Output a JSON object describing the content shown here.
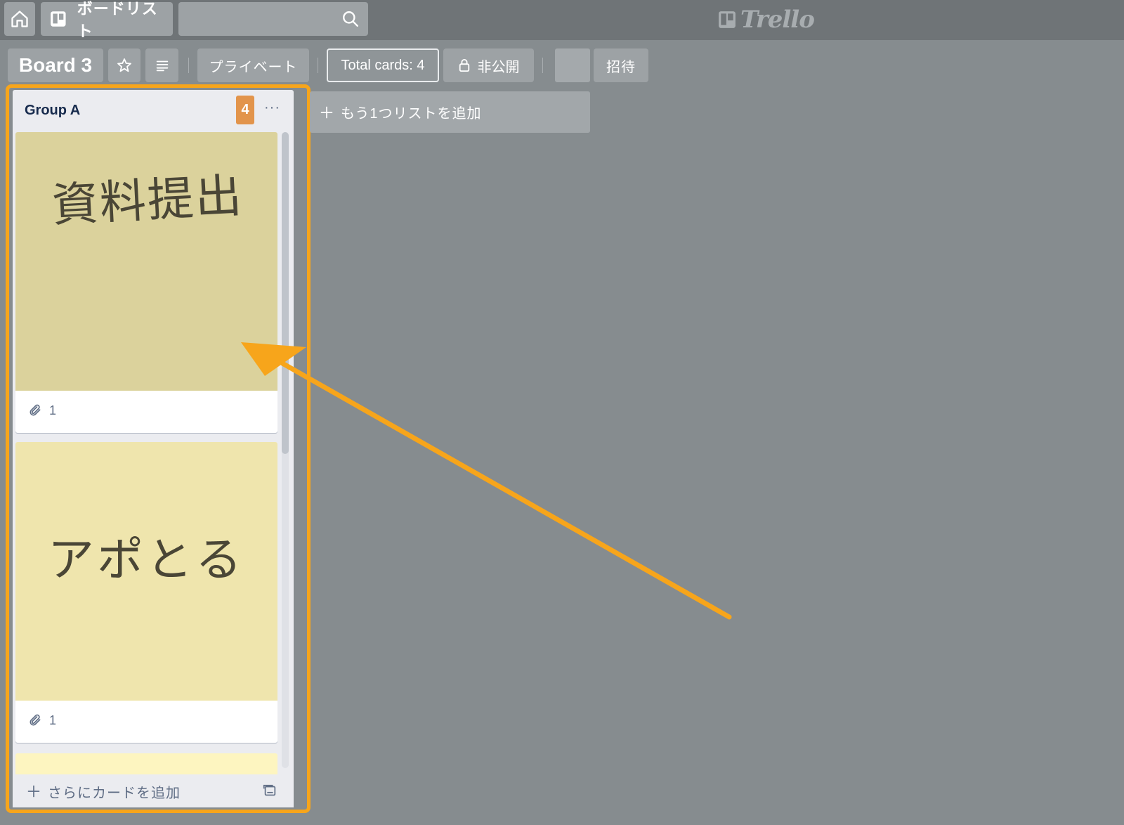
{
  "header": {
    "boards_label": "ボードリスト",
    "search_placeholder": "",
    "logo_text": "Trello"
  },
  "board": {
    "title": "Board 3",
    "visibility_label": "プライベート",
    "total_cards_label": "Total cards: 4",
    "privacy_label": "非公開",
    "invite_label": "招待"
  },
  "list": {
    "title": "Group A",
    "card_count": "4",
    "menu_glyph": "···",
    "cards": [
      {
        "handwritten_text": "資料提出",
        "attachment_count": "1"
      },
      {
        "handwritten_text": "アポとる",
        "attachment_count": "1"
      }
    ],
    "add_card_label": "さらにカードを追加"
  },
  "add_list_label": "もう1つリストを追加",
  "colors": {
    "highlight": "#f7a51b",
    "arrow": "#f7a51b",
    "count_badge": "#e2944b",
    "card1_image": "#dbd29c",
    "card2_image": "#efe5ad",
    "board_bg": "#868c8f"
  },
  "icons": [
    "home-icon",
    "board-icon",
    "search-icon",
    "star-icon",
    "menu-icon",
    "lock-icon",
    "paperclip-icon",
    "plus-icon",
    "template-icon"
  ]
}
